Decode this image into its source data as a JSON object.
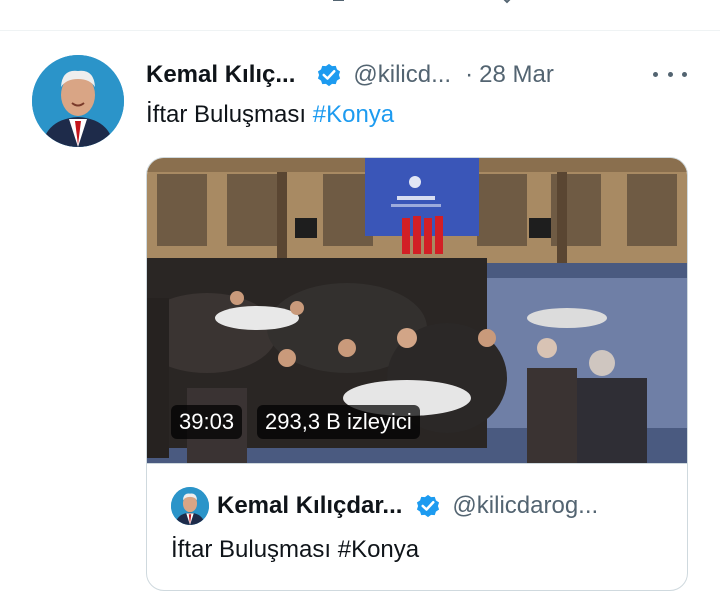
{
  "tweet": {
    "author_name": "Kemal Kılıç...",
    "handle": "@kilicd...",
    "separator": "·",
    "date": "28 Mar",
    "text_plain": "İftar Buluşması ",
    "hashtag": "#Konya"
  },
  "quoted": {
    "video_duration": "39:03",
    "viewer_count": "293,3 B izleyici",
    "author_name": "Kemal Kılıçdar...",
    "handle": "@kilicdarog...",
    "text": "İftar Buluşması #Konya"
  },
  "colors": {
    "accent": "#1d9bf0",
    "text": "#0f1419",
    "secondary": "#536471",
    "border": "#cfd9de"
  },
  "icons": [
    "reply-icon",
    "retweet-icon",
    "like-icon",
    "share-icon",
    "verified-badge-icon",
    "more-options-icon"
  ]
}
